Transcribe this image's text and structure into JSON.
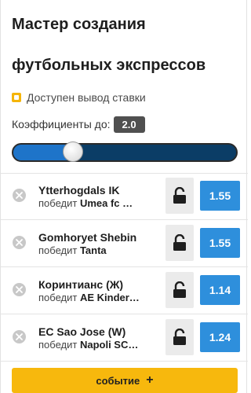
{
  "header": {
    "title_line1": "Мастер создания",
    "title_line2": "футбольных экспрессов"
  },
  "cashout": {
    "label": "Доступен вывод ставки",
    "icon": "cashout-icon",
    "color": "#f5b50a"
  },
  "coefficient": {
    "label": "Коэффициенты до:",
    "value": "2.0",
    "slider_level": 0.27
  },
  "outcome_prefix": "победит",
  "events": [
    {
      "team": "Ytterhogdals IK",
      "winner": "Umea fc …",
      "odd": "1.55"
    },
    {
      "team": "Gomhoryet Shebin",
      "winner": "Tanta",
      "odd": "1.55"
    },
    {
      "team": "Коринтианс (Ж)",
      "winner": "AE Kinder…",
      "odd": "1.14"
    },
    {
      "team": "EC Sao Jose (W)",
      "winner": "Napoli SC…",
      "odd": "1.24"
    }
  ],
  "add_event": {
    "label": "событие",
    "icon": "plus-icon"
  },
  "colors": {
    "accent": "#f7b80d",
    "odd_button": "#2e8fdc",
    "slider_fill": "#1e74c9",
    "slider_track": "#0b3d66"
  }
}
